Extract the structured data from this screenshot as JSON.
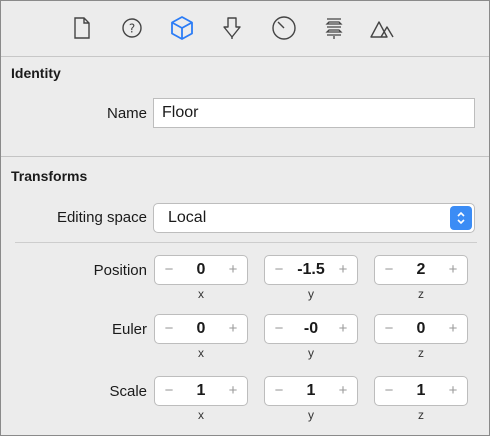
{
  "toolbar": {
    "icons": [
      "file-icon",
      "help-icon",
      "cube-icon",
      "arrow-down-icon",
      "gauge-icon",
      "layers-icon",
      "shapes-icon"
    ],
    "active_color": "#2b7cf6"
  },
  "identity": {
    "heading": "Identity",
    "name_label": "Name",
    "name_value": "Floor"
  },
  "transforms": {
    "heading": "Transforms",
    "editing_space_label": "Editing space",
    "editing_space_value": "Local",
    "minus_glyph": "−",
    "plus_glyph": "+",
    "rows": [
      {
        "label": "Position",
        "values": [
          "0",
          "-1.5",
          "2"
        ]
      },
      {
        "label": "Euler",
        "values": [
          "0",
          "-0",
          "0"
        ]
      },
      {
        "label": "Scale",
        "values": [
          "1",
          "1",
          "1"
        ]
      }
    ],
    "axes": [
      "x",
      "y",
      "z"
    ]
  }
}
